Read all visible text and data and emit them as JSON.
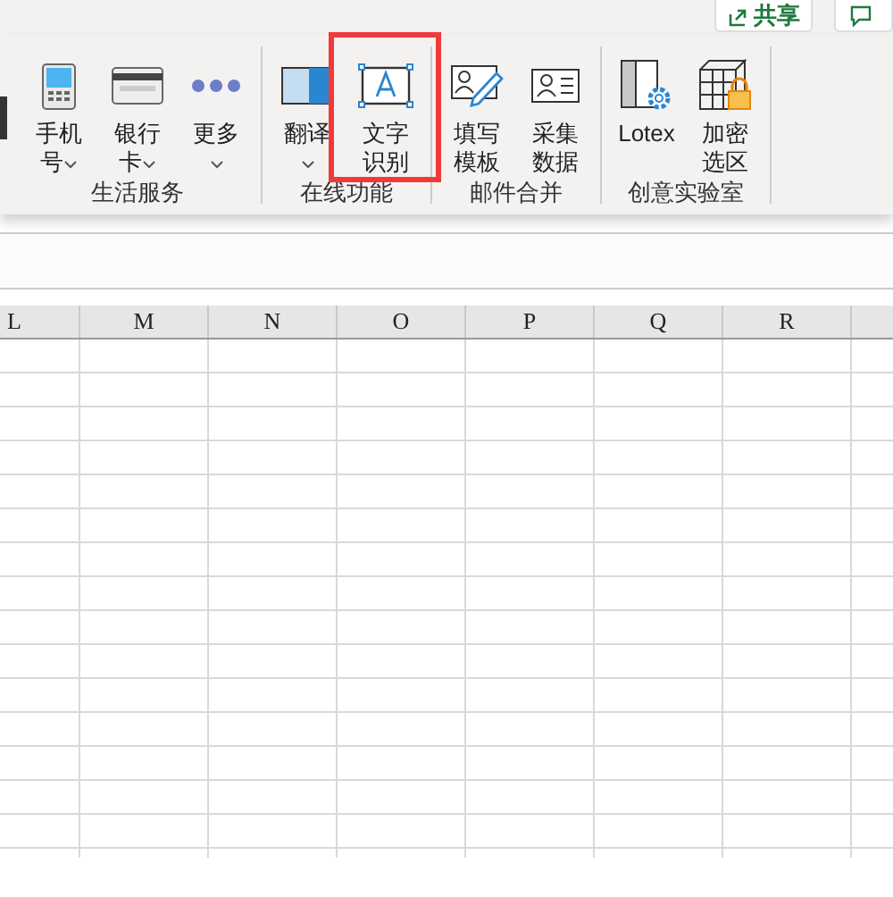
{
  "top_bar": {
    "share_button": {
      "label": "共享"
    }
  },
  "ribbon": {
    "groups": [
      {
        "title": "生活服务",
        "buttons": [
          {
            "kind": "phone",
            "label": "手机号",
            "dropdown": true
          },
          {
            "kind": "card",
            "label": "银行卡",
            "dropdown": true
          },
          {
            "kind": "more",
            "label": "更多",
            "dropdown": true
          }
        ]
      },
      {
        "title": "在线功能",
        "buttons": [
          {
            "kind": "translate",
            "label": "翻译",
            "dropdown": true
          },
          {
            "kind": "ocr",
            "label": "文字识别",
            "dropdown": false
          }
        ]
      },
      {
        "title": "邮件合并",
        "buttons": [
          {
            "kind": "fill",
            "label": "填写模板",
            "dropdown": false
          },
          {
            "kind": "collect",
            "label": "采集数据",
            "dropdown": false
          }
        ]
      },
      {
        "title": "创意实验室",
        "buttons": [
          {
            "kind": "lotex",
            "label": "Lotex",
            "dropdown": false
          },
          {
            "kind": "encrypt",
            "label": "加密选区",
            "dropdown": false
          }
        ]
      }
    ]
  },
  "sheet": {
    "columns": [
      "L",
      "M",
      "N",
      "O",
      "P",
      "Q",
      "R"
    ]
  }
}
